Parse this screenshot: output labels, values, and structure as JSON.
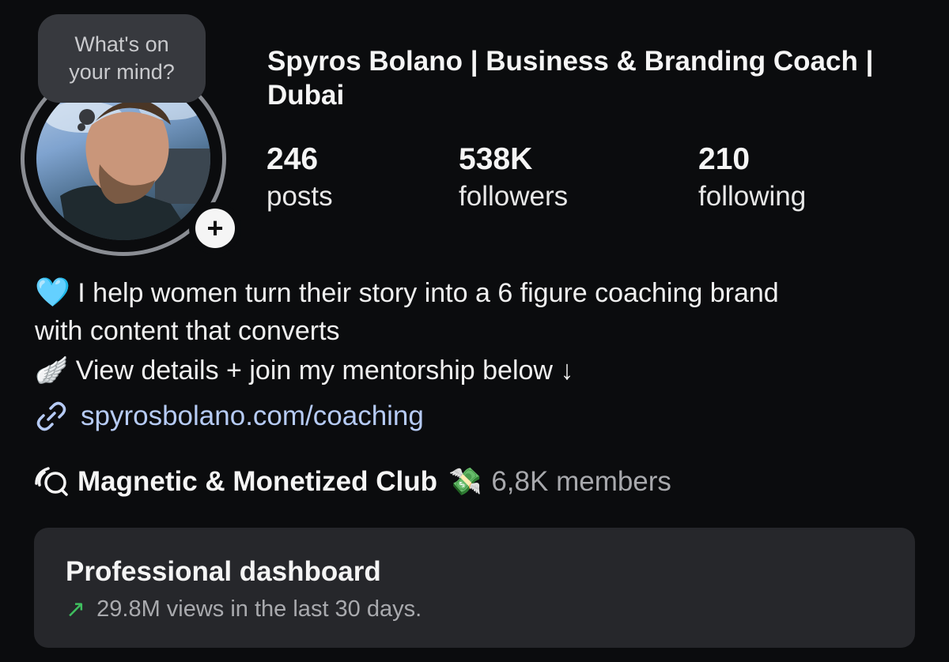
{
  "profile": {
    "note_placeholder_line1": "What's on",
    "note_placeholder_line2": "your mind?",
    "add_story_symbol": "+",
    "display_name": "Spyros Bolano | Business & Branding Coach | Dubai",
    "stats": [
      {
        "value": "246",
        "label": "posts"
      },
      {
        "value": "538K",
        "label": "followers"
      },
      {
        "value": "210",
        "label": "following"
      }
    ]
  },
  "bio": {
    "line1_emoji": "🩵",
    "line1_text": "I help women turn their story into a 6 figure coaching brand",
    "line2_text": "with content that converts",
    "line3_emoji": "🪽",
    "line3_text": "View details + join my mentorship below ↓",
    "link_text": "spyrosbolano.com/coaching"
  },
  "channel": {
    "name": "Magnetic & Monetized Club",
    "emoji": "💸",
    "members": "6,8K members"
  },
  "dashboard": {
    "title": "Professional dashboard",
    "trend_symbol": "↗",
    "subtitle": "29.8M views in the last 30 days."
  },
  "colors": {
    "background": "#0b0c0e",
    "link": "#b6cbf5",
    "trend": "#3fbf5f",
    "card": "#26272b"
  }
}
